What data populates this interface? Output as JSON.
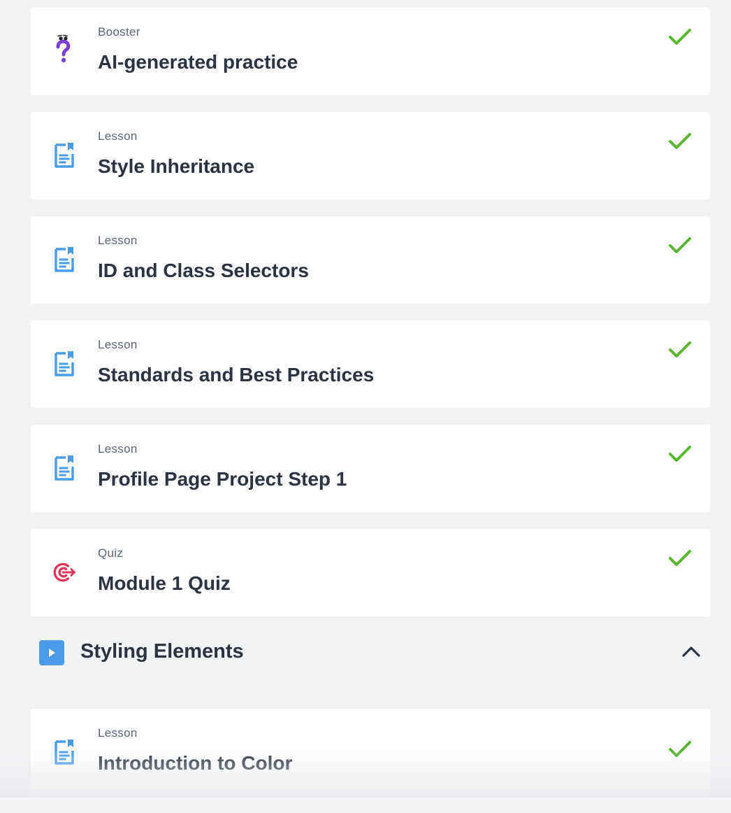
{
  "items": [
    {
      "type": "Booster",
      "title": "AI-generated practice",
      "icon": "booster-question-icon",
      "completed": true
    },
    {
      "type": "Lesson",
      "title": "Style Inheritance",
      "icon": "lesson-document-icon",
      "completed": true
    },
    {
      "type": "Lesson",
      "title": "ID and Class Selectors",
      "icon": "lesson-document-icon",
      "completed": true
    },
    {
      "type": "Lesson",
      "title": "Standards and Best Practices",
      "icon": "lesson-document-icon",
      "completed": true
    },
    {
      "type": "Lesson",
      "title": "Profile Page Project Step 1",
      "icon": "lesson-document-icon",
      "completed": true
    },
    {
      "type": "Quiz",
      "title": "Module 1 Quiz",
      "icon": "quiz-target-icon",
      "completed": true
    }
  ],
  "section": {
    "title": "Styling Elements",
    "icon": "play-icon",
    "toggle_icon": "chevron-up-icon",
    "expanded": true
  },
  "section_items": [
    {
      "type": "Lesson",
      "title": "Introduction to Color",
      "icon": "lesson-document-icon",
      "completed": true
    }
  ],
  "colors": {
    "background": "#f2f3f5",
    "card": "#ffffff",
    "check": "#5cb335",
    "lesson_icon": "#4a9be8",
    "quiz_icon": "#e0335a",
    "booster_icon": "#7a3fd1",
    "text": "#2b3340",
    "muted": "#5c6675"
  }
}
